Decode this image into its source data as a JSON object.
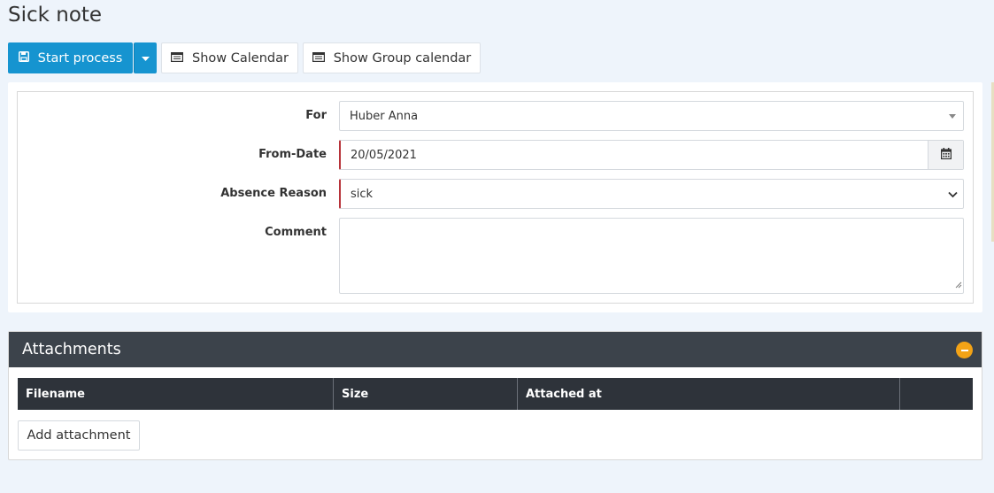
{
  "page": {
    "title": "Sick note"
  },
  "toolbar": {
    "start_label": "Start process",
    "calendar_label": "Show Calendar",
    "group_calendar_label": "Show Group calendar"
  },
  "form": {
    "for_label": "For",
    "for_value": "Huber Anna",
    "from_date_label": "From-Date",
    "from_date_value": "20/05/2021",
    "absence_reason_label": "Absence Reason",
    "absence_reason_value": "sick",
    "comment_label": "Comment",
    "comment_value": ""
  },
  "attachments": {
    "title": "Attachments",
    "columns": [
      "Filename",
      "Size",
      "Attached at",
      ""
    ],
    "rows": [],
    "add_label": "Add attachment"
  },
  "colors": {
    "primary": "#1694d0",
    "header_dark": "#3c434b",
    "table_head": "#2e333a",
    "collapse": "#f3a316",
    "required": "#b7333a",
    "background": "#eef4fb"
  },
  "icons": {
    "start": "save-icon",
    "dropdown": "caret-down-icon",
    "calendar": "calendar-list-icon",
    "date_picker": "calendar-icon",
    "collapse": "minus-circle-icon"
  }
}
